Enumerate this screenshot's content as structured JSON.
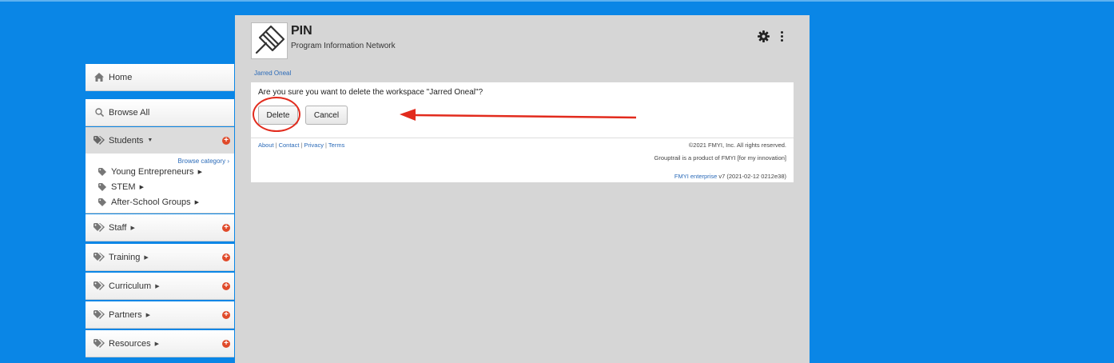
{
  "app": {
    "title": "PIN",
    "subtitle": "Program Information Network"
  },
  "breadcrumb": "Jarred Oneal",
  "dialog": {
    "question": "Are you sure you want to delete the workspace \"Jarred Oneal\"?",
    "delete_label": "Delete",
    "cancel_label": "Cancel"
  },
  "sidebar": {
    "home": "Home",
    "browse_all": "Browse All",
    "browse_category": "Browse category",
    "categories": [
      {
        "label": "Students"
      },
      {
        "label": "Staff"
      },
      {
        "label": "Training"
      },
      {
        "label": "Curriculum"
      },
      {
        "label": "Partners"
      },
      {
        "label": "Resources"
      }
    ],
    "student_subitems": [
      {
        "label": "Young Entrepreneurs"
      },
      {
        "label": "STEM"
      },
      {
        "label": "After-School Groups"
      }
    ]
  },
  "footer": {
    "links": [
      "About",
      "Contact",
      "Privacy",
      "Terms"
    ],
    "copyright": "©2021 FMYI, Inc. All rights reserved.",
    "product_line": "Grouptrail is a product of FMYI [for my innovation]",
    "enterprise_link": "FMYI enterprise",
    "version": "v7 (2021-02-12 0212e38)"
  },
  "colors": {
    "background": "#0a86e6",
    "panel": "#d6d6d6",
    "link": "#2a6ab8",
    "add": "#e04a2a",
    "annotation": "#e22b1d"
  }
}
